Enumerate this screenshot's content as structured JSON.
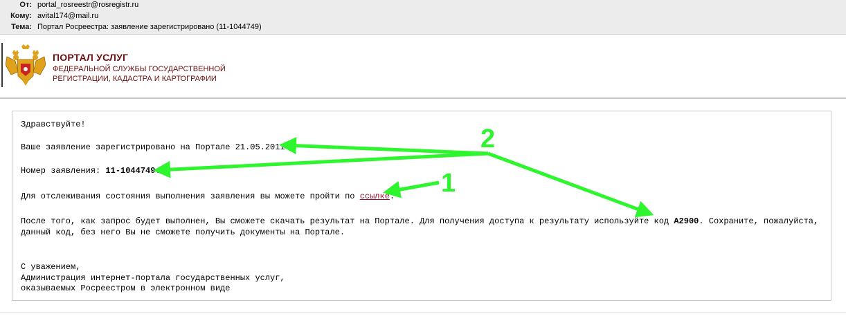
{
  "header": {
    "from_label": "От:",
    "from_value": "portal_rosreestr@rosregistr.ru",
    "to_label": "Кому:",
    "to_value": "avital174@mail.ru",
    "subject_label": "Тема:",
    "subject_value": "Портал Росреестра: заявление зарегистрировано  (11-1044749)"
  },
  "logo": {
    "title": "ПОРТАЛ УСЛУГ",
    "subtitle_line1": "ФЕДЕРАЛЬНОЙ СЛУЖБЫ ГОСУДАРСТВЕННОЙ",
    "subtitle_line2": "РЕГИСТРАЦИИ, КАДАСТРА И КАРТОГРАФИИ",
    "emblem_icon": "double-headed-eagle-emblem",
    "title_color": "#6b1010"
  },
  "body": {
    "greeting": "Здравствуйте!",
    "registered_text": "Ваше заявление зарегистрировано на Портале 21.05.2011.",
    "number_label": "Номер заявления: ",
    "number_value": "11-1044749",
    "number_end": ".",
    "tracking_text": "Для отслеживания состояния выполнения заявления вы можете пройти по ",
    "tracking_link": "ссылке",
    "tracking_end": ".",
    "result_text_a": "После того, как запрос будет выполнен, Вы сможете скачать результат на Портале. Для получения доступа к результату используйте код ",
    "result_code": "A2900",
    "result_text_b": ". Сохраните, пожалуйста,",
    "result_line2": "данный код, без него Вы не сможете получить документы на Портале.",
    "sign1": "С уважением,",
    "sign2": "Администрация интернет-портала государственных услуг,",
    "sign3": "оказываемых Росреестром в электронном виде",
    "link_color": "#9c0c2c"
  },
  "annotations": {
    "label_1": "1",
    "label_2": "2",
    "arrow_color": "#2ef52e"
  }
}
